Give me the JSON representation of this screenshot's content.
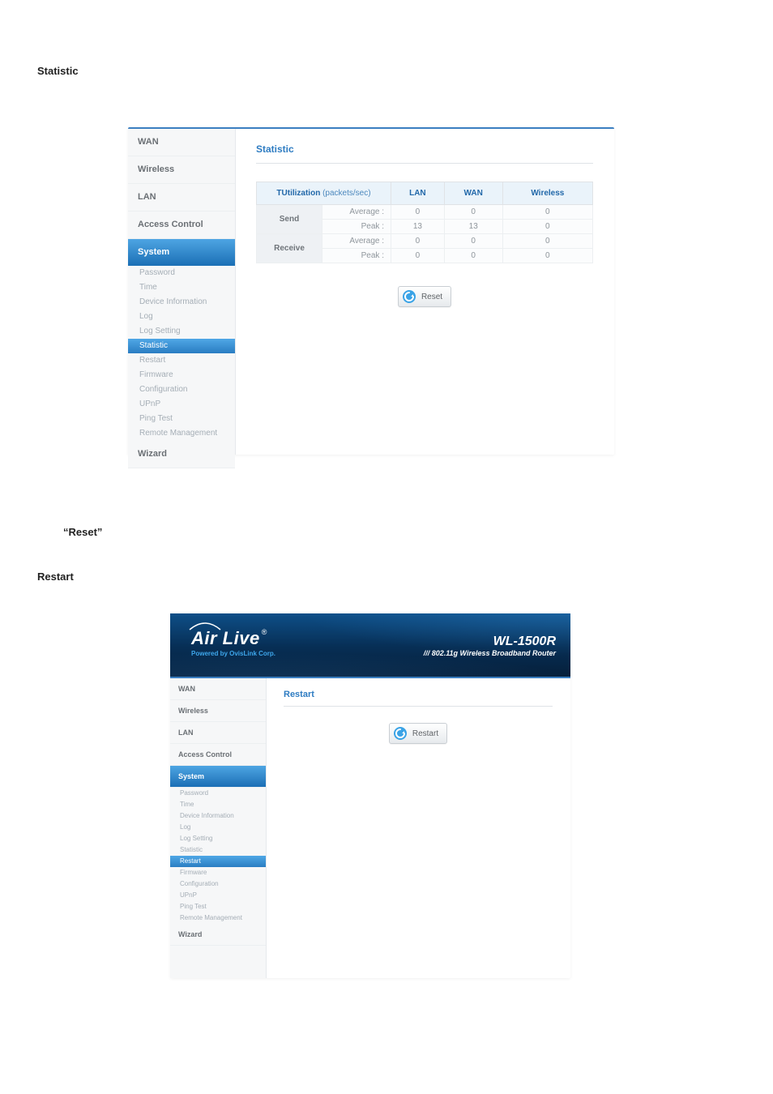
{
  "headings": {
    "statistic": "Statistic",
    "reset": "“Reset”",
    "restart": "Restart"
  },
  "panel1": {
    "sidebar": {
      "main": [
        "WAN",
        "Wireless",
        "LAN",
        "Access Control",
        "System",
        "Wizard"
      ],
      "active_main_index": 4,
      "sub": [
        "Password",
        "Time",
        "Device Information",
        "Log",
        "Log Setting",
        "Statistic",
        "Restart",
        "Firmware",
        "Configuration",
        "UPnP",
        "Ping Test",
        "Remote Management"
      ],
      "active_sub_index": 5
    },
    "title": "Statistic",
    "table": {
      "header_utilization": "TUtilization",
      "header_utilization_unit": "(packets/sec)",
      "col_LAN": "LAN",
      "col_WAN": "WAN",
      "col_Wireless": "Wireless",
      "rows": [
        {
          "dir": "Send",
          "metric": "Average :",
          "lan": "0",
          "wan": "0",
          "wireless": "0"
        },
        {
          "dir": "",
          "metric": "Peak :",
          "lan": "13",
          "wan": "13",
          "wireless": "0"
        },
        {
          "dir": "Receive",
          "metric": "Average :",
          "lan": "0",
          "wan": "0",
          "wireless": "0"
        },
        {
          "dir": "",
          "metric": "Peak :",
          "lan": "0",
          "wan": "0",
          "wireless": "0"
        }
      ]
    },
    "reset_button": "Reset"
  },
  "panel2": {
    "brand_main": "Air Live",
    "brand_reg": "®",
    "brand_sub": "Powered by OvisLink Corp.",
    "model": "WL-1500R",
    "model_sub": "/// 802.11g Wireless Broadband Router",
    "sidebar": {
      "main": [
        "WAN",
        "Wireless",
        "LAN",
        "Access Control",
        "System",
        "Wizard"
      ],
      "active_main_index": 4,
      "sub": [
        "Password",
        "Time",
        "Device Information",
        "Log",
        "Log Setting",
        "Statistic",
        "Restart",
        "Firmware",
        "Configuration",
        "UPnP",
        "Ping Test",
        "Remote Management"
      ],
      "active_sub_index": 6
    },
    "title": "Restart",
    "restart_button": "Restart"
  }
}
